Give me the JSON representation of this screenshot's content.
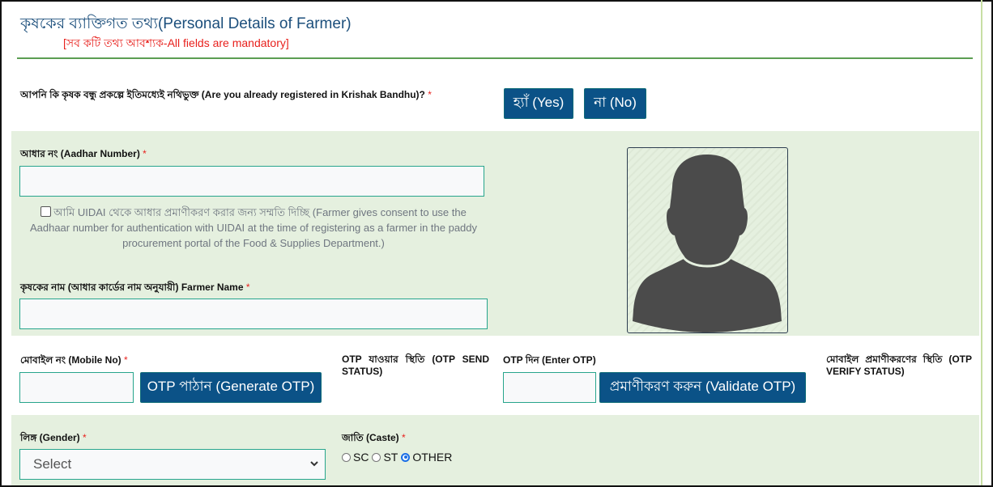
{
  "header": {
    "title": "কৃষকের ব্যাক্তিগত তথ্য(Personal Details of Farmer)",
    "subtitle": "[সব কটি তথ্য আবশ্যক-All fields are mandatory]"
  },
  "registered": {
    "question": "আপনি কি কৃষক বন্ধু প্রকল্পে ইতিমধ্যেই নথিভুক্ত (Are you already registered in Krishak Bandhu)?",
    "required_mark": "*",
    "yes_label": "হ্যাঁ (Yes)",
    "no_label": "না (No)"
  },
  "aadhar": {
    "label": "আধার নং (Aadhar Number)",
    "required_mark": "*",
    "value": "",
    "consent_checked": false,
    "consent_text": "আমি UIDAI থেকে আধার প্রমাণীকরণ করার জন্য সম্মতি দিচ্ছি (Farmer gives consent to use the Aadhaar number for authentication with UIDAI at the time of registering as a farmer in the paddy procurement portal of the Food & Supplies Department.)"
  },
  "farmer_name": {
    "label": "কৃষকের নাম (আধার কার্ডের নাম অনুযায়ী) Farmer Name",
    "required_mark": "*",
    "value": ""
  },
  "photo": {
    "icon": "user-silhouette-icon"
  },
  "mobile": {
    "label": "মোবাইল নং (Mobile No)",
    "required_mark": "*",
    "value": "",
    "generate_otp_label": "OTP পাঠান (Generate OTP)",
    "otp_send_status_label": "OTP যাওয়ার স্থিতি (OTP SEND STATUS)",
    "enter_otp_label": "OTP দিন (Enter OTP)",
    "otp_value": "",
    "validate_otp_label": "প্রমাণীকরণ করুন (Validate OTP)",
    "otp_verify_status_label": "মোবাইল প্রমাণীকরণের স্থিতি (OTP VERIFY STATUS)"
  },
  "gender": {
    "label": "লিঙ্গ (Gender)",
    "required_mark": "*",
    "selected": "Select"
  },
  "caste": {
    "label": "জাতি (Caste)",
    "required_mark": "*",
    "options": [
      {
        "label": "SC",
        "checked": false
      },
      {
        "label": "ST",
        "checked": false
      },
      {
        "label": "OTHER",
        "checked": true
      }
    ]
  },
  "colors": {
    "button_bg": "#0b5287",
    "band_bg": "#e5f0df",
    "title": "#1c4f7c",
    "required": "#e8211d",
    "rule": "#5b9e52"
  }
}
